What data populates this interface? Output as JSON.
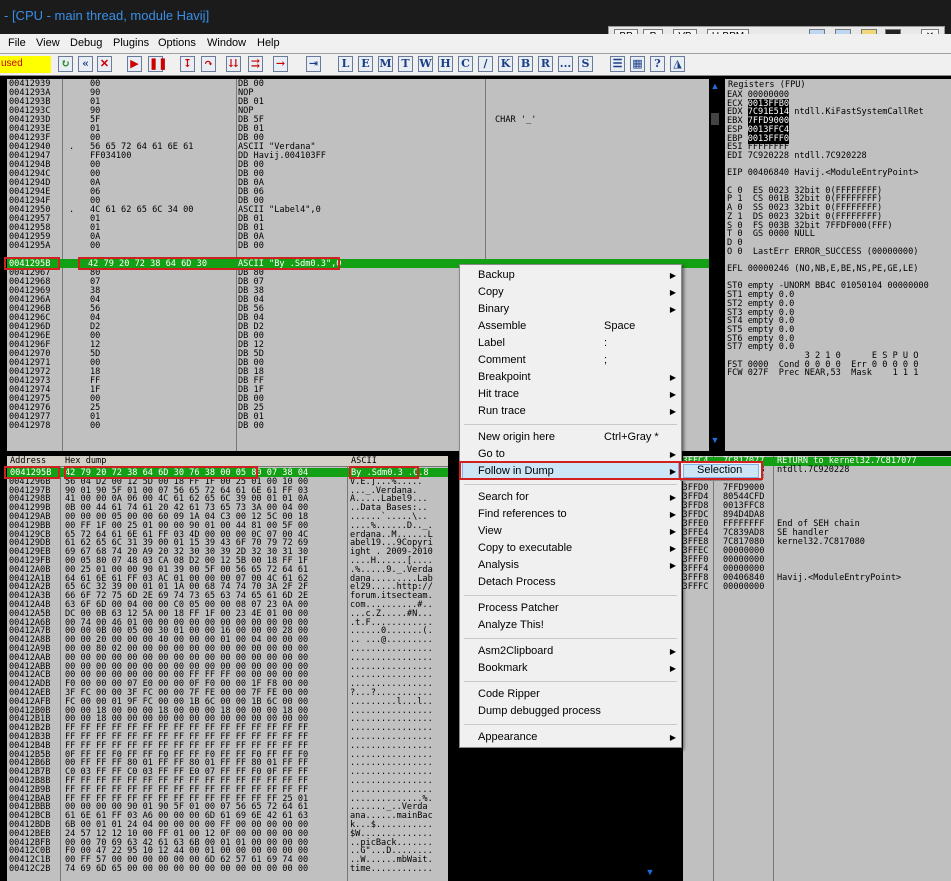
{
  "window": {
    "title": "- [CPU - main thread, module Havij]"
  },
  "menu": [
    "File",
    "View",
    "Debug",
    "Plugins",
    "Options",
    "Window",
    "Help"
  ],
  "bp_buttons": [
    "BP",
    "P",
    "VB",
    "U-BPM"
  ],
  "status": "used",
  "toolbar_letters": [
    "L",
    "E",
    "M",
    "T",
    "W",
    "H",
    "C",
    "/",
    "K",
    "B",
    "R",
    "...",
    "S"
  ],
  "disasm": {
    "rows": [
      [
        "00412939",
        "00",
        "",
        "DB 00"
      ],
      [
        "0041293A",
        "90",
        "",
        "NOP"
      ],
      [
        "0041293B",
        "01",
        "",
        "DB 01"
      ],
      [
        "0041293C",
        "90",
        "",
        "NOP"
      ],
      [
        "0041293D",
        "5F",
        "",
        "DB 5F"
      ],
      [
        "0041293E",
        "01",
        "",
        "DB 01"
      ],
      [
        "0041293F",
        "00",
        "",
        "DB 00"
      ],
      [
        "00412940",
        ".",
        "56 65 72 64 61 6E 61",
        "ASCII \"Verdana\""
      ],
      [
        "00412947",
        "",
        "FF034100",
        "DD Havij.004103FF"
      ],
      [
        "0041294B",
        "00",
        "",
        "DB 00"
      ],
      [
        "0041294C",
        "00",
        "",
        "DB 00"
      ],
      [
        "0041294D",
        "0A",
        "",
        "DB 0A"
      ],
      [
        "0041294E",
        "06",
        "",
        "DB 06"
      ],
      [
        "0041294F",
        "00",
        "",
        "DB 00"
      ],
      [
        "00412950",
        ".",
        "4C 61 62 65 6C 34 00",
        "ASCII \"Label4\",0"
      ],
      [
        "00412957",
        "01",
        "",
        "DB 01"
      ],
      [
        "00412958",
        "01",
        "",
        "DB 01"
      ],
      [
        "00412959",
        "0A",
        "",
        "DB 0A"
      ],
      [
        "0041295A",
        "00",
        "",
        "DB 00"
      ],
      [
        "0041295B",
        "",
        "42 79 20 72 38 64 6D 30",
        "ASCII \"By .Sdm0.3\",0"
      ],
      [
        "00412966",
        "05",
        "",
        "DB 05"
      ],
      [
        "00412967",
        "80",
        "",
        "DB 80"
      ],
      [
        "00412968",
        "07",
        "",
        "DB 07"
      ],
      [
        "00412969",
        "38",
        "",
        "DB 38"
      ],
      [
        "0041296A",
        "04",
        "",
        "DB 04"
      ],
      [
        "0041296B",
        "56",
        "",
        "DB 56"
      ],
      [
        "0041296C",
        "04",
        "",
        "DB 04"
      ],
      [
        "0041296D",
        "D2",
        "",
        "DB D2"
      ],
      [
        "0041296E",
        "00",
        "",
        "DB 00"
      ],
      [
        "0041296F",
        "12",
        "",
        "DB 12"
      ],
      [
        "00412970",
        "5D",
        "",
        "DB 5D"
      ],
      [
        "00412971",
        "00",
        "",
        "DB 00"
      ],
      [
        "00412972",
        "18",
        "",
        "DB 18"
      ],
      [
        "00412973",
        "FF",
        "",
        "DB FF"
      ],
      [
        "00412974",
        "1F",
        "",
        "DB 1F"
      ],
      [
        "00412975",
        "00",
        "",
        "DB 00"
      ],
      [
        "00412976",
        "25",
        "",
        "DB 25"
      ],
      [
        "00412977",
        "01",
        "",
        "DB 01"
      ],
      [
        "00412978",
        "00",
        "",
        "DB 00"
      ]
    ],
    "comment": "CHAR '_'"
  },
  "registers": {
    "header": "Registers (FPU)",
    "lines": [
      "EAX 00000000",
      "ECX 0013FFB0",
      "EDX 7C91E514 ntdll.KiFastSystemCallRet",
      "EBX 7FFD9000",
      "ESP 0013FFC4",
      "EBP 0013FFF0",
      "ESI FFFFFFFF",
      "EDI 7C920228 ntdll.7C920228",
      "",
      "EIP 00406840 Havij.<ModuleEntryPoint>",
      "",
      "C 0  ES 0023 32bit 0(FFFFFFFF)",
      "P 1  CS 001B 32bit 0(FFFFFFFF)",
      "A 0  SS 0023 32bit 0(FFFFFFFF)",
      "Z 1  DS 0023 32bit 0(FFFFFFFF)",
      "S 0  FS 003B 32bit 7FFDF000(FFF)",
      "T 0  GS 0000 NULL",
      "D 0",
      "O 0  LastErr ERROR_SUCCESS (00000000)",
      "",
      "EFL 00000246 (NO,NB,E,BE,NS,PE,GE,LE)",
      "",
      "ST0 empty -UNORM BB4C 01050104 00000000",
      "ST1 empty 0.0",
      "ST2 empty 0.0",
      "ST3 empty 0.0",
      "ST4 empty 0.0",
      "ST5 empty 0.0",
      "ST6 empty 0.0",
      "ST7 empty 0.0",
      "               3 2 1 0      E S P U O",
      "FST 0000  Cond 0 0 0 0  Err 0 0 0 0 0",
      "FCW 027F  Prec NEAR,53  Mask    1 1 1"
    ]
  },
  "dump": {
    "header_address": "Address",
    "header_hex": "Hex dump",
    "header_ascii": "ASCII",
    "rows": [
      [
        "0041295B",
        "42 79 20 72 38 64 6D 30 76 38 00 05 80 07 38 04",
        "By .Sdm0.3 .C.8"
      ],
      [
        "0041296B",
        "56 04 D2 00 12 5D 00 18 FF 1F 00 25 01 00 10 00",
        "V.E.]...%....."
      ],
      [
        "0041297B",
        "90 01 90 5F 01 00 07 56 65 72 64 61 6E 61 FF 03",
        "..._.Verdana."
      ],
      [
        "0041298B",
        "41 00 00 0A 06 00 4C 61 62 65 6C 39 00 01 01 0A",
        "A.....Label9..."
      ],
      [
        "0041299B",
        "0B 00 44 61 74 61 20 42 61 73 65 73 3A 00 04 00",
        "..Data Bases:.."
      ],
      [
        "004129AB",
        "00 00 00 05 00 00 60 09 1A 04 C3 00 12 5C 00 18",
        "......`.....\\.."
      ],
      [
        "004129BB",
        "00 FF 1F 00 25 01 00 00 90 01 00 44 81 00 5F 00",
        "....%......D.._."
      ],
      [
        "004129CB",
        "65 72 64 61 6E 61 FF 03 4D 00 00 00 0C 07 00 4C",
        "erdana..M......L"
      ],
      [
        "004129DB",
        "61 62 65 6C 31 39 00 01 15 39 43 6F 70 79 72 69",
        "abel19...9Copyri"
      ],
      [
        "004129EB",
        "69 67 68 74 20 A9 20 32 30 30 39 2D 32 30 31 30",
        "ight . 2009-2010"
      ],
      [
        "004129FB",
        "00 05 80 07 48 03 CA 08 D2 00 12 5B 00 18 FF 1F",
        "....H......[...."
      ],
      [
        "00412A0B",
        "00 25 01 00 00 90 01 39 00 5F 00 56 65 72 64 61",
        ".%.....9._.Verda"
      ],
      [
        "00412A1B",
        "64 61 6E 61 FF 03 AC 01 00 00 00 07 00 4C 61 62",
        "dana.........Lab"
      ],
      [
        "00412A2B",
        "65 6C 32 39 00 01 01 1A 00 68 74 74 70 3A 2F 2F",
        "el29.....http://"
      ],
      [
        "00412A3B",
        "66 6F 72 75 6D 2E 69 74 73 65 63 74 65 61 6D 2E",
        "forum.itsecteam."
      ],
      [
        "00412A4B",
        "63 6F 6D 00 04 00 00 C0 05 00 00 08 07 23 0A 00",
        "com..........#.."
      ],
      [
        "00412A5B",
        "DC 00 0B 63 12 5A 00 18 FF 1F 00 23 4E 01 00 00",
        "...c.Z.....#N..."
      ],
      [
        "00412A6B",
        "00 74 00 46 01 00 00 00 00 00 00 00 00 00 00 00",
        ".t.F............"
      ],
      [
        "00412A7B",
        "00 00 0B 00 05 00 30 01 00 00 16 00 00 00 28 00",
        "......0.......(."
      ],
      [
        "00412A8B",
        "00 00 20 00 00 00 40 00 00 00 01 00 04 00 00 00",
        ".. ...@........."
      ],
      [
        "00412A9B",
        "00 00 80 02 00 00 00 00 00 00 00 00 00 00 00 00",
        "................"
      ],
      [
        "00412AAB",
        "00 00 00 00 00 00 00 00 00 00 00 00 00 00 00 00",
        "................"
      ],
      [
        "00412ABB",
        "00 00 00 00 00 00 00 00 00 00 00 00 00 00 00 00",
        "................"
      ],
      [
        "00412ACB",
        "00 00 00 00 00 00 00 00 FF FF FF 00 00 00 00 00",
        "................"
      ],
      [
        "00412ADB",
        "F0 00 00 00 07 E0 00 00 0F F0 00 00 1F F8 00 00",
        "................"
      ],
      [
        "00412AEB",
        "3F FC 00 00 3F FC 00 00 7F FE 00 00 7F FE 00 00",
        "?...?..........."
      ],
      [
        "00412AFB",
        "FC 00 00 01 9F FC 00 00 1B 6C 00 00 1B 6C 00 00",
        ".........l...l.."
      ],
      [
        "00412B0B",
        "00 00 18 00 00 00 18 00 00 00 18 00 00 00 18 00",
        "................"
      ],
      [
        "00412B1B",
        "00 00 18 00 00 00 00 00 00 00 00 00 00 00 00 00",
        "................"
      ],
      [
        "00412B2B",
        "FF FF FF FF FF FF FF FF FF FF FF FF FF FF FF FF",
        "................"
      ],
      [
        "00412B3B",
        "FF FF FF FF FF FF FF FF FF FF FF FF FF FF FF FF",
        "................"
      ],
      [
        "00412B4B",
        "FF FF FF FF FF FF FF FF FF FF FF FF FF FF FF FF",
        "................"
      ],
      [
        "00412B5B",
        "0F FF FF F0 FF FF F0 FF FF F0 FF FF F0 FF FF F0",
        "................"
      ],
      [
        "00412B6B",
        "00 FF FF FF 80 01 FF FF 80 01 FF FF 80 01 FF FF",
        "................"
      ],
      [
        "00412B7B",
        "C0 03 FF FF C0 03 FF FF E0 07 FF FF F0 0F FF FF",
        "................"
      ],
      [
        "00412B8B",
        "FF FF FF FF FF FF FF FF FF FF FF FF FF FF FF FF",
        "................"
      ],
      [
        "00412B9B",
        "FF FF FF FF FF FF FF FF FF FF FF FF FF FF FF FF",
        "................"
      ],
      [
        "00412BAB",
        "FF FF FF FF FF FF FF FF FF FF FF FF FF FF 25 01",
        "..............%."
      ],
      [
        "00412BBB",
        "00 00 00 00 90 01 90 5F 01 00 07 56 65 72 64 61",
        "......._..Verda"
      ],
      [
        "00412BCB",
        "61 6E 61 FF 03 A6 00 00 00 6D 61 69 6E 42 61 63",
        "ana......mainBac"
      ],
      [
        "00412BDB",
        "6B 00 01 01 24 04 00 00 00 00 FF 00 00 00 00 00",
        "k...$..........."
      ],
      [
        "00412BEB",
        "24 57 12 12 10 00 FF 01 00 12 0F 00 00 00 00 00",
        "$W.............."
      ],
      [
        "00412BFB",
        "00 00 70 69 63 42 61 63 6B 00 01 01 00 00 00 00",
        "..picBack......."
      ],
      [
        "00412C0B",
        "F0 00 47 22 95 10 12 44 00 01 00 00 00 00 00 00",
        "..G\"...D........"
      ],
      [
        "00412C1B",
        "00 FF 57 00 00 00 00 00 00 6D 62 57 61 69 74 00",
        "..W......mbWait."
      ],
      [
        "00412C2B",
        "74 69 6D 65 00 00 00 00 00 00 00 00 00 00 00 00",
        "time............"
      ]
    ]
  },
  "stack": {
    "rows": [
      [
        "0013FFC4",
        "7C817077",
        "RETURN to kernel32.7C817077"
      ],
      [
        "0013FFC8",
        "7C920228",
        "ntdll.7C920228"
      ],
      [
        "0013FFCC",
        "FFFFFFFF",
        ""
      ],
      [
        "0013FFD0",
        "7FFD9000",
        ""
      ],
      [
        "0013FFD4",
        "80544CFD",
        ""
      ],
      [
        "0013FFD8",
        "0013FFC8",
        ""
      ],
      [
        "0013FFDC",
        "894D4DA8",
        ""
      ],
      [
        "0013FFE0",
        "FFFFFFFF",
        "End of SEH chain"
      ],
      [
        "0013FFE4",
        "7C839AD8",
        "SE handler"
      ],
      [
        "0013FFE8",
        "7C817080",
        "kernel32.7C817080"
      ],
      [
        "0013FFEC",
        "00000000",
        ""
      ],
      [
        "0013FFF0",
        "00000000",
        ""
      ],
      [
        "0013FFF4",
        "00000000",
        ""
      ],
      [
        "0013FFF8",
        "00406840",
        "Havij.<ModuleEntryPoint>"
      ],
      [
        "0013FFFC",
        "00000000",
        ""
      ]
    ]
  },
  "context_menu": {
    "items": [
      {
        "label": "Backup",
        "shortcut": "",
        "submenu": true
      },
      {
        "label": "Copy",
        "shortcut": "",
        "submenu": true
      },
      {
        "label": "Binary",
        "shortcut": "",
        "submenu": true
      },
      {
        "label": "Assemble",
        "shortcut": "Space",
        "submenu": false
      },
      {
        "label": "Label",
        "shortcut": ":",
        "submenu": false
      },
      {
        "label": "Comment",
        "shortcut": ";",
        "submenu": false
      },
      {
        "label": "Breakpoint",
        "shortcut": "",
        "submenu": true
      },
      {
        "label": "Hit trace",
        "shortcut": "",
        "submenu": true
      },
      {
        "label": "Run trace",
        "shortcut": "",
        "submenu": true
      },
      {
        "sep": true
      },
      {
        "label": "New origin here",
        "shortcut": "Ctrl+Gray *",
        "submenu": false
      },
      {
        "label": "Go to",
        "shortcut": "",
        "submenu": true
      },
      {
        "label": "Follow in Dump",
        "shortcut": "",
        "submenu": true,
        "active": true
      },
      {
        "sep": true
      },
      {
        "label": "Search for",
        "shortcut": "",
        "submenu": true
      },
      {
        "label": "Find references to",
        "shortcut": "",
        "submenu": true
      },
      {
        "label": "View",
        "shortcut": "",
        "submenu": true
      },
      {
        "label": "Copy to executable",
        "shortcut": "",
        "submenu": true
      },
      {
        "label": "Analysis",
        "shortcut": "",
        "submenu": true
      },
      {
        "label": "Detach Process",
        "shortcut": "",
        "submenu": false
      },
      {
        "sep": true
      },
      {
        "label": "Process Patcher",
        "shortcut": "",
        "submenu": false
      },
      {
        "label": "Analyze This!",
        "shortcut": "",
        "submenu": false
      },
      {
        "sep": true
      },
      {
        "label": "Asm2Clipboard",
        "shortcut": "",
        "submenu": true
      },
      {
        "label": "Bookmark",
        "shortcut": "",
        "submenu": true
      },
      {
        "sep": true
      },
      {
        "label": "Code Ripper",
        "shortcut": "",
        "submenu": false
      },
      {
        "label": "Dump debugged process",
        "shortcut": "",
        "submenu": false
      },
      {
        "sep": true
      },
      {
        "label": "Appearance",
        "shortcut": "",
        "submenu": true
      }
    ],
    "submenu_label": "Selection"
  },
  "colors": {
    "highlight": "#14a014",
    "pane": "#c0c0c0",
    "red_box": "#d02020",
    "accent": "#1c6de0"
  }
}
